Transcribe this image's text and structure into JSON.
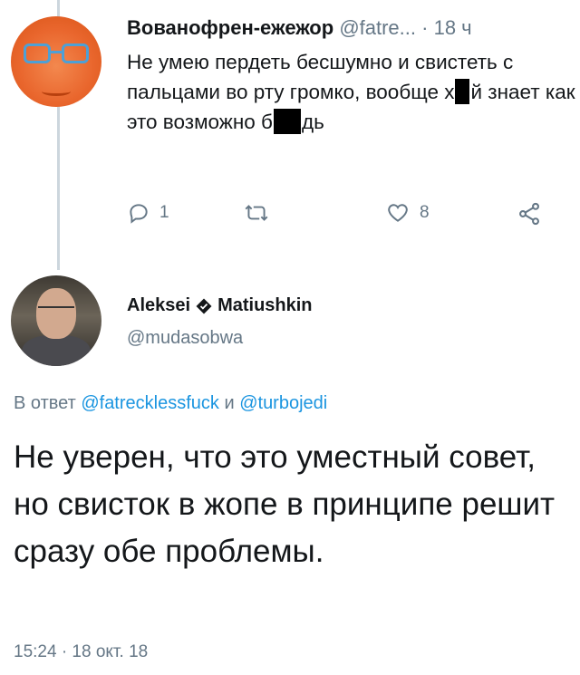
{
  "tweet1": {
    "author_name": "Вованофрен-ежежор",
    "handle": "@fatre...",
    "time": "· 18 ч",
    "text_parts": {
      "p1": "Не умею пердеть бесшумно и свистеть с пальцами во рту громко, вообще х",
      "p2": "й знает как это возможно б",
      "p3": "дь"
    },
    "actions": {
      "reply_count": "1",
      "retweet_count": "",
      "like_count": "8"
    },
    "icons": [
      "reply-icon",
      "retweet-icon",
      "like-icon",
      "share-icon"
    ]
  },
  "tweet2": {
    "author_name": "Aleksei",
    "author_surname": "Matiushkin",
    "handle": "@mudasobwa",
    "reply_prefix": "В ответ",
    "reply_mention1": "@fatrecklessfuck",
    "reply_and": "и",
    "reply_mention2": "@turbojedi",
    "text": "Не уверен, что это уместный совет, но свисток в жопе в принципе решит сразу обе проблемы.",
    "timestamp": "15:24 · 18 окт. 18"
  },
  "colors": {
    "text": "#14171a",
    "secondary": "#657786",
    "link": "#1b95e0",
    "thread_line": "#ccd6dd",
    "avatar1_orange": "#e9662d"
  }
}
